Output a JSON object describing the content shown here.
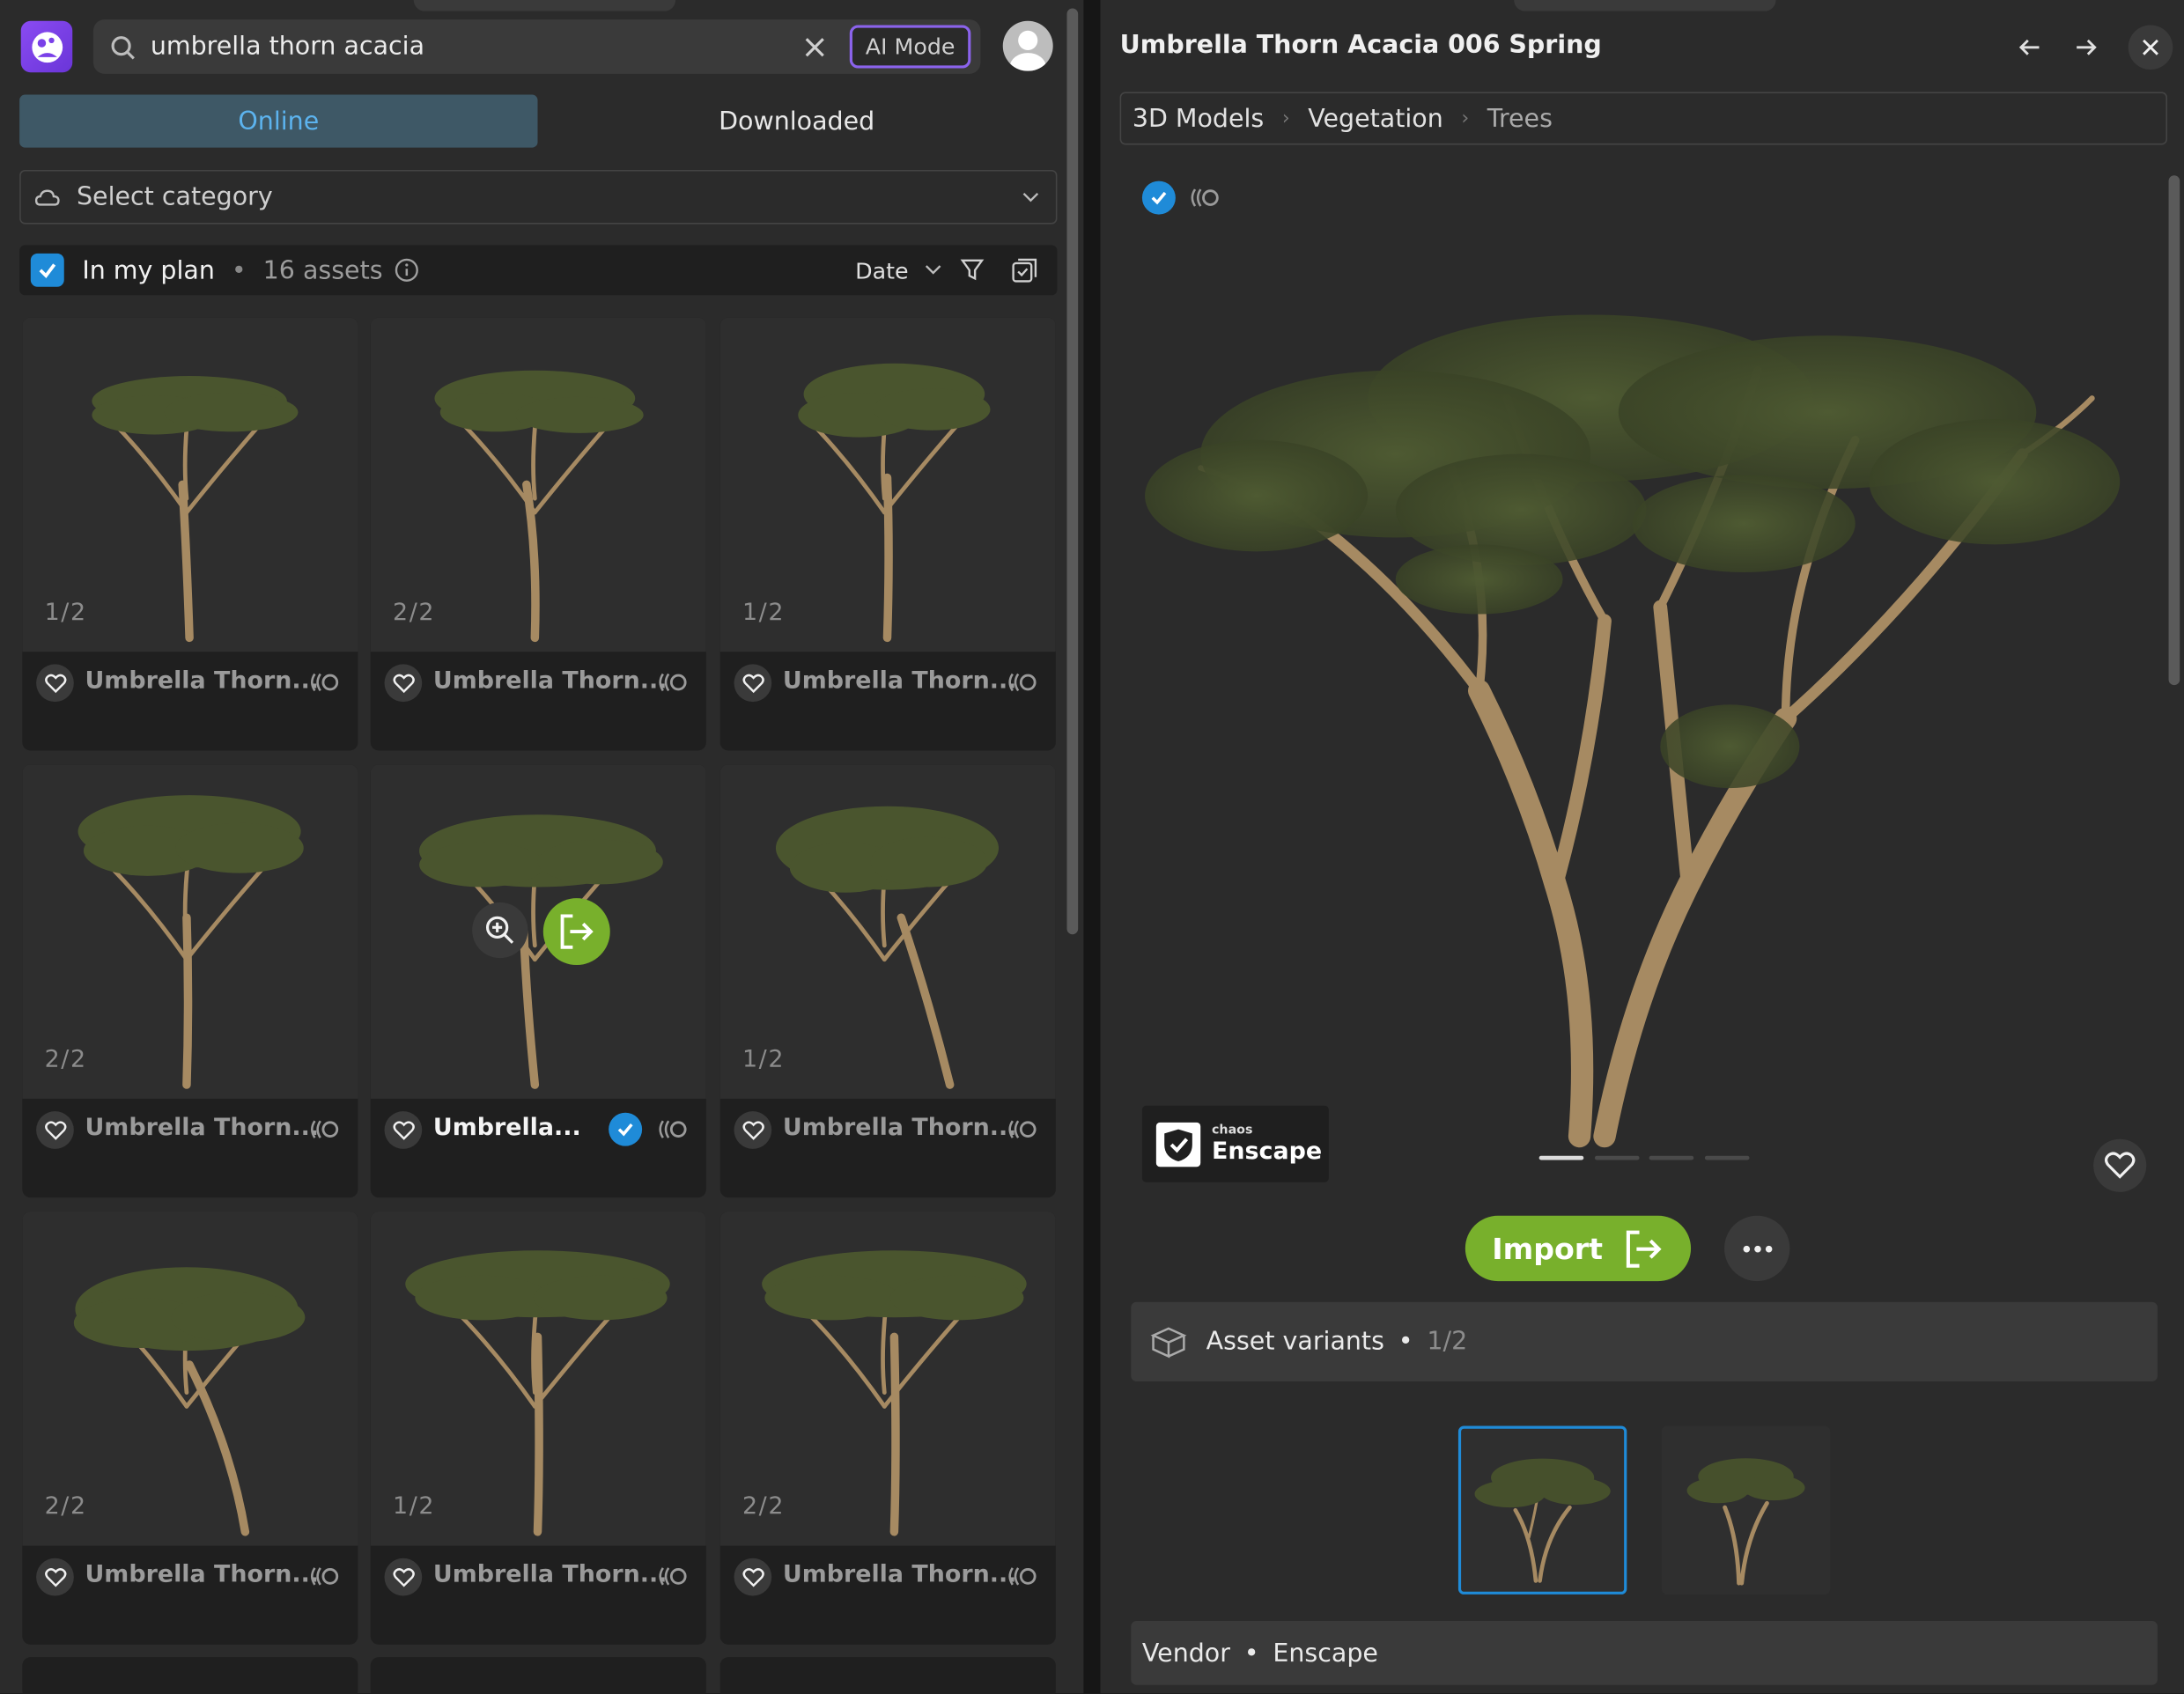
{
  "search": {
    "value": "umbrella thorn acacia",
    "ai_mode_label": "AI Mode"
  },
  "tabs": {
    "online": "Online",
    "downloaded": "Downloaded"
  },
  "category": {
    "placeholder": "Select category"
  },
  "filter": {
    "plan_label": "In my plan",
    "bullet": "•",
    "asset_count": "16 assets",
    "sort_label": "Date",
    "in_plan_checked": true
  },
  "cards": [
    {
      "variant": "1/2",
      "title": "Umbrella Thorn...",
      "selected": false
    },
    {
      "variant": "2/2",
      "title": "Umbrella Thorn...",
      "selected": false
    },
    {
      "variant": "1/2",
      "title": "Umbrella Thorn...",
      "selected": false
    },
    {
      "variant": "2/2",
      "title": "Umbrella Thorn...",
      "selected": false
    },
    {
      "variant": "",
      "title": "Umbrella...",
      "selected": true
    },
    {
      "variant": "1/2",
      "title": "Umbrella Thorn...",
      "selected": false
    },
    {
      "variant": "2/2",
      "title": "Umbrella Thorn...",
      "selected": false
    },
    {
      "variant": "1/2",
      "title": "Umbrella Thorn...",
      "selected": false
    },
    {
      "variant": "2/2",
      "title": "Umbrella Thorn...",
      "selected": false
    }
  ],
  "detail": {
    "title": "Umbrella Thorn Acacia 006 Spring",
    "breadcrumb": [
      "3D Models",
      "Vegetation",
      "Trees"
    ],
    "breadcrumb_sep": "›",
    "brand_small": "chaos",
    "brand_name": "Enscape",
    "import_label": "Import",
    "variants_label": "Asset variants",
    "variants_bullet": "•",
    "variants_count": "1/2",
    "vendor_label": "Vendor",
    "vendor_bullet": "•",
    "vendor_name": "Enscape",
    "carousel_pages": 4,
    "carousel_active": 1
  },
  "colors": {
    "accent_blue": "#1f8bd8",
    "import_green": "#78b02c",
    "ai_purple": "#8b63ec",
    "online_tab": "#3e5866"
  },
  "icons": [
    "logo-icon",
    "search-icon",
    "close-icon",
    "user-icon",
    "cloud-icon",
    "chevron-down-icon",
    "info-icon",
    "filter-icon",
    "select-all-icon",
    "heart-icon",
    "chaos-icon",
    "zoom-in-icon",
    "import-icon",
    "arrow-left-icon",
    "arrow-right-icon",
    "ellipsis-icon",
    "cube-icon",
    "check-icon"
  ]
}
